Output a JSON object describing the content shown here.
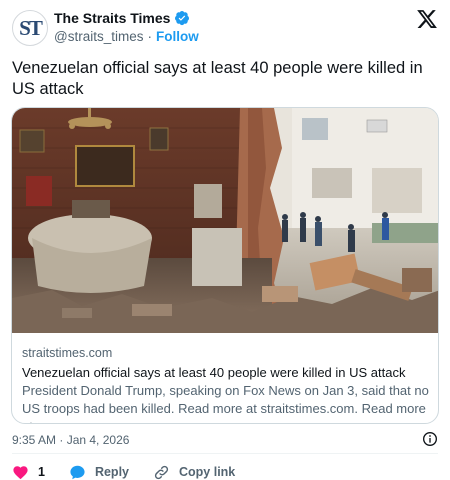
{
  "account": {
    "display_name": "The Straits Times",
    "handle": "@straits_times",
    "separator": "·",
    "follow_label": "Follow",
    "avatar_text": "ST",
    "verified": true
  },
  "tweet": {
    "text": "Venezuelan official says at least 40 people were killed in US attack"
  },
  "card": {
    "image_alt": "Destroyed room with rubble and people in the street outside",
    "domain": "straitstimes.com",
    "title": "Venezuelan official says at least 40 people were killed in US attack",
    "description": "President Donald Trump, speaking on Fox News on Jan 3, said that no US troops had been killed. Read more at straitstimes.com. Read more at ..."
  },
  "meta": {
    "timestamp": "9:35 AM · Jan 4, 2026"
  },
  "actions": {
    "like_count": "1",
    "reply_label": "Reply",
    "copy_link_label": "Copy link"
  },
  "colors": {
    "accent": "#1d9bf0",
    "like": "#f91880",
    "text_primary": "#0f1419",
    "text_secondary": "#536471",
    "border": "#cfd9de",
    "avatar_brand": "#2b4a73"
  },
  "icons": {
    "verified": "verified-badge-icon",
    "brand": "x-logo-icon",
    "info": "info-icon",
    "like": "heart-icon",
    "reply": "speech-bubble-icon",
    "copy_link": "link-icon"
  }
}
